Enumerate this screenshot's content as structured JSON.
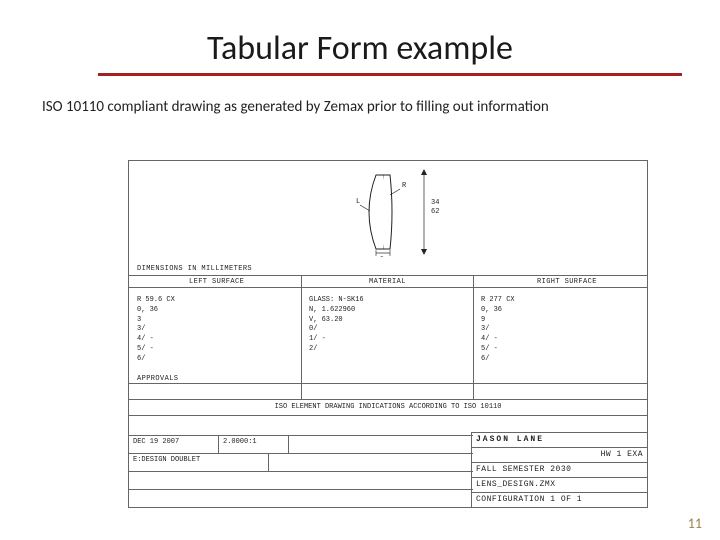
{
  "title": "Tabular Form example",
  "subtitle": "ISO 10110 compliant drawing as generated by Zemax prior to filling out information",
  "page_number": "11",
  "drawing": {
    "diameter_label": "34\n62",
    "dim_note": "DIMENSIONS IN MILLIMETERS",
    "sections": {
      "left": "LEFT SURFACE",
      "material": "MATERIAL",
      "right": "RIGHT SURFACE"
    },
    "left_col": [
      "R 59.6 CX",
      "0, 36",
      "3",
      "3/",
      "4/ -",
      "5/ -",
      "6/"
    ],
    "mid_col": [
      "GLASS: N-SK16",
      "N, 1.622960",
      "V, 63.20",
      "",
      "0/",
      "1/ -",
      "2/"
    ],
    "right_col": [
      "R 277 CX",
      "0, 36",
      "9",
      "3/",
      "4/ -",
      "5/ -",
      "6/"
    ],
    "approvals": "APPROVALS",
    "iso_caption": "ISO ELEMENT DRAWING INDICATIONS ACCORDING TO ISO 10110",
    "bl1": {
      "a": "DEC 19 2007",
      "b": "2.0000:1"
    },
    "bl2": "E:DESIGN DOUBLET",
    "titleblock": {
      "l1": "JASON LANE",
      "l2": "HW 1 EXA",
      "l3": "FALL SEMESTER 2030",
      "l4": "LENS_DESIGN.ZMX",
      "l5": "CONFIGURATION 1 OF 1"
    }
  }
}
